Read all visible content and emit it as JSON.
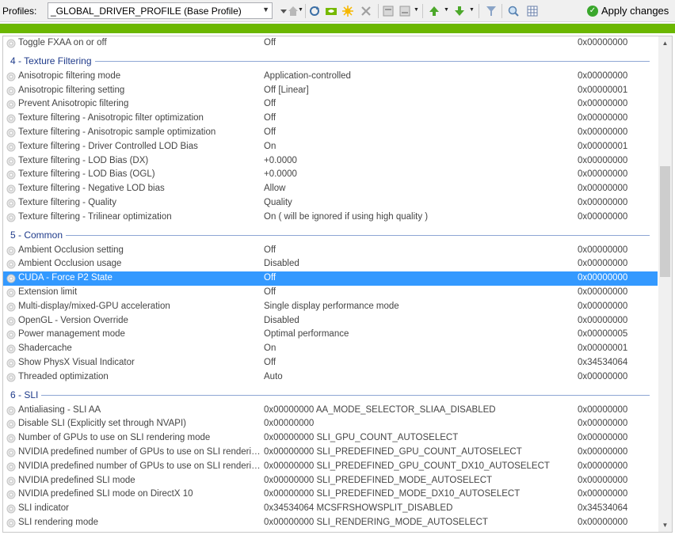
{
  "toolbar": {
    "profiles_label": "Profiles:",
    "profile_value": "_GLOBAL_DRIVER_PROFILE (Base Profile)",
    "apply_label": "Apply changes",
    "icons": [
      "dropdown-arrow",
      "home-icon",
      "refresh-icon",
      "nvidia-icon",
      "star-icon",
      "delete-icon",
      "export-icon",
      "import-icon",
      "green-up-icon",
      "green-down-icon",
      "filter-icon",
      "search-icon",
      "grid-icon"
    ]
  },
  "progress": {
    "fraction": 1.0,
    "color": "#6bb700"
  },
  "colors": {
    "selected": "#3399ff",
    "group_text": "#1e3a8a",
    "group_line": "#8ea6d4",
    "apply_icon": "#3aa72c"
  },
  "rows": [
    {
      "type": "setting",
      "name": "Toggle FXAA on or off",
      "value": "Off",
      "hex": "0x00000000"
    },
    {
      "type": "group",
      "label": "4 - Texture Filtering"
    },
    {
      "type": "setting",
      "name": "Anisotropic filtering mode",
      "value": "Application-controlled",
      "hex": "0x00000000"
    },
    {
      "type": "setting",
      "name": "Anisotropic filtering setting",
      "value": "Off [Linear]",
      "hex": "0x00000001"
    },
    {
      "type": "setting",
      "name": "Prevent Anisotropic filtering",
      "value": "Off",
      "hex": "0x00000000"
    },
    {
      "type": "setting",
      "name": "Texture filtering - Anisotropic filter optimization",
      "value": "Off",
      "hex": "0x00000000"
    },
    {
      "type": "setting",
      "name": "Texture filtering - Anisotropic sample optimization",
      "value": "Off",
      "hex": "0x00000000"
    },
    {
      "type": "setting",
      "name": "Texture filtering - Driver Controlled LOD Bias",
      "value": "On",
      "hex": "0x00000001"
    },
    {
      "type": "setting",
      "name": "Texture filtering - LOD Bias (DX)",
      "value": "+0.0000",
      "hex": "0x00000000"
    },
    {
      "type": "setting",
      "name": "Texture filtering - LOD Bias (OGL)",
      "value": "+0.0000",
      "hex": "0x00000000"
    },
    {
      "type": "setting",
      "name": "Texture filtering - Negative LOD bias",
      "value": "Allow",
      "hex": "0x00000000"
    },
    {
      "type": "setting",
      "name": "Texture filtering - Quality",
      "value": "Quality",
      "hex": "0x00000000"
    },
    {
      "type": "setting",
      "name": "Texture filtering - Trilinear optimization",
      "value": "On ( will be ignored if using high quality )",
      "hex": "0x00000000"
    },
    {
      "type": "group",
      "label": "5 - Common"
    },
    {
      "type": "setting",
      "name": "Ambient Occlusion setting",
      "value": "Off",
      "hex": "0x00000000"
    },
    {
      "type": "setting",
      "name": "Ambient Occlusion usage",
      "value": "Disabled",
      "hex": "0x00000000"
    },
    {
      "type": "setting",
      "name": "CUDA - Force P2 State",
      "value": "Off",
      "hex": "0x00000000",
      "selected": true
    },
    {
      "type": "setting",
      "name": "Extension limit",
      "value": "Off",
      "hex": "0x00000000"
    },
    {
      "type": "setting",
      "name": "Multi-display/mixed-GPU acceleration",
      "value": "Single display performance mode",
      "hex": "0x00000000"
    },
    {
      "type": "setting",
      "name": "OpenGL - Version Override",
      "value": "Disabled",
      "hex": "0x00000000"
    },
    {
      "type": "setting",
      "name": "Power management mode",
      "value": "Optimal performance",
      "hex": "0x00000005"
    },
    {
      "type": "setting",
      "name": "Shadercache",
      "value": "On",
      "hex": "0x00000001"
    },
    {
      "type": "setting",
      "name": "Show PhysX Visual Indicator",
      "value": "Off",
      "hex": "0x34534064"
    },
    {
      "type": "setting",
      "name": "Threaded optimization",
      "value": "Auto",
      "hex": "0x00000000"
    },
    {
      "type": "group",
      "label": "6 - SLI"
    },
    {
      "type": "setting",
      "name": "Antialiasing - SLI AA",
      "value": "0x00000000 AA_MODE_SELECTOR_SLIAA_DISABLED",
      "hex": "0x00000000"
    },
    {
      "type": "setting",
      "name": "Disable SLI (Explicitly set through NVAPI)",
      "value": "0x00000000",
      "hex": "0x00000000"
    },
    {
      "type": "setting",
      "name": "Number of GPUs to use on SLI rendering mode",
      "value": "0x00000000 SLI_GPU_COUNT_AUTOSELECT",
      "hex": "0x00000000"
    },
    {
      "type": "setting",
      "name": "NVIDIA predefined number of GPUs to use on SLI rendering m...",
      "value": "0x00000000 SLI_PREDEFINED_GPU_COUNT_AUTOSELECT",
      "hex": "0x00000000"
    },
    {
      "type": "setting",
      "name": "NVIDIA predefined number of GPUs to use on SLI rendering m...",
      "value": "0x00000000 SLI_PREDEFINED_GPU_COUNT_DX10_AUTOSELECT",
      "hex": "0x00000000"
    },
    {
      "type": "setting",
      "name": "NVIDIA predefined SLI mode",
      "value": "0x00000000 SLI_PREDEFINED_MODE_AUTOSELECT",
      "hex": "0x00000000"
    },
    {
      "type": "setting",
      "name": "NVIDIA predefined SLI mode on DirectX 10",
      "value": "0x00000000 SLI_PREDEFINED_MODE_DX10_AUTOSELECT",
      "hex": "0x00000000"
    },
    {
      "type": "setting",
      "name": "SLI indicator",
      "value": "0x34534064 MCSFRSHOWSPLIT_DISABLED",
      "hex": "0x34534064"
    },
    {
      "type": "setting",
      "name": "SLI rendering mode",
      "value": "0x00000000 SLI_RENDERING_MODE_AUTOSELECT",
      "hex": "0x00000000"
    }
  ]
}
